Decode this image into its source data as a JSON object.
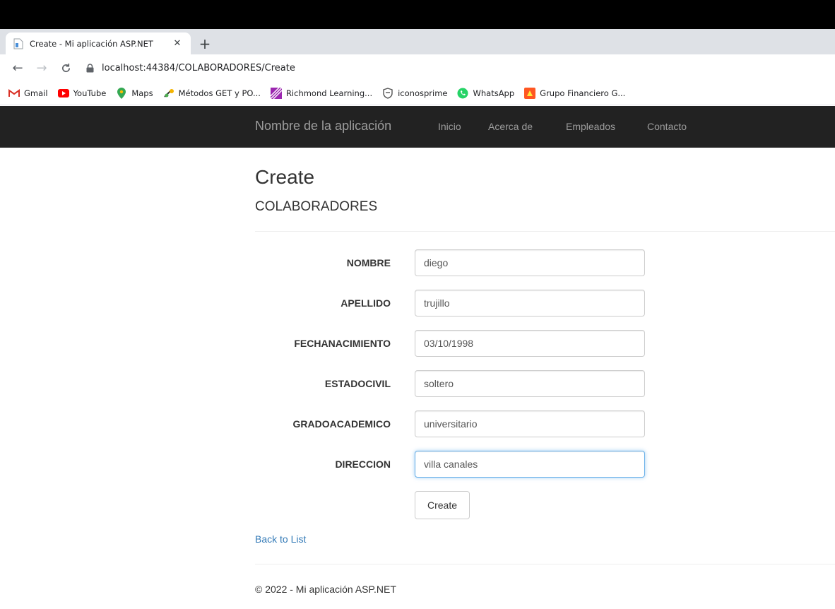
{
  "browser": {
    "tab": {
      "title": "Create - Mi aplicación ASP.NET",
      "close_label": "✕"
    },
    "new_tab_label": "+",
    "url": "localhost:44384/COLABORADORES/Create",
    "bookmarks": [
      {
        "label": "Gmail",
        "icon": "gmail-icon"
      },
      {
        "label": "YouTube",
        "icon": "youtube-icon"
      },
      {
        "label": "Maps",
        "icon": "maps-icon"
      },
      {
        "label": "Métodos GET y PO...",
        "icon": "bookmark-favicon"
      },
      {
        "label": "Richmond Learning...",
        "icon": "richmond-icon"
      },
      {
        "label": "iconosprime",
        "icon": "shield-icon"
      },
      {
        "label": "WhatsApp",
        "icon": "whatsapp-icon"
      },
      {
        "label": "Grupo Financiero G...",
        "icon": "bank-icon"
      }
    ]
  },
  "navbar": {
    "brand": "Nombre de la aplicación",
    "links": [
      "Inicio",
      "Acerca de",
      "Empleados",
      "Contacto"
    ]
  },
  "page": {
    "title": "Create",
    "subtitle": "COLABORADORES"
  },
  "form": {
    "fields": [
      {
        "label": "NOMBRE",
        "value": "diego"
      },
      {
        "label": "APELLIDO",
        "value": "trujillo"
      },
      {
        "label": "FECHANACIMIENTO",
        "value": "03/10/1998"
      },
      {
        "label": "ESTADOCIVIL",
        "value": "soltero"
      },
      {
        "label": "GRADOACADEMICO",
        "value": "universitario"
      },
      {
        "label": "DIRECCION",
        "value": "villa canales"
      }
    ],
    "submit_label": "Create"
  },
  "back_link": "Back to List",
  "footer": "© 2022 - Mi aplicación ASP.NET",
  "colors": {
    "navbar_bg": "#222222",
    "navbar_text": "#9d9d9d",
    "link": "#337ab7",
    "focus_border": "#66afe9"
  }
}
